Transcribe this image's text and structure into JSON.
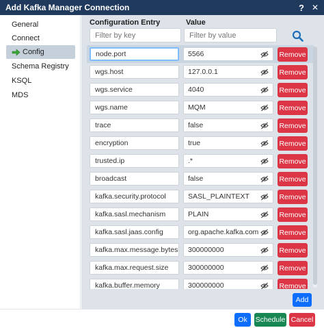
{
  "window": {
    "title": "Add Kafka Manager Connection",
    "help_label": "?",
    "close_label": "✕"
  },
  "sidebar": {
    "items": [
      {
        "label": "General"
      },
      {
        "label": "Connect"
      },
      {
        "label": "Config"
      },
      {
        "label": "Schema Registry"
      },
      {
        "label": "KSQL"
      },
      {
        "label": "MDS"
      }
    ],
    "active": "Config"
  },
  "config": {
    "key_header": "Configuration Entry",
    "value_header": "Value",
    "key_filter_placeholder": "Filter by key",
    "value_filter_placeholder": "Filter by value",
    "remove_label": "Remove",
    "add_label": "Add",
    "entries": [
      {
        "key": "node.port",
        "value": "5566"
      },
      {
        "key": "wgs.host",
        "value": "127.0.0.1"
      },
      {
        "key": "wgs.service",
        "value": "4040"
      },
      {
        "key": "wgs.name",
        "value": "MQM"
      },
      {
        "key": "trace",
        "value": "false"
      },
      {
        "key": "encryption",
        "value": "true"
      },
      {
        "key": "trusted.ip",
        "value": ".*"
      },
      {
        "key": "broadcast",
        "value": "false"
      },
      {
        "key": "kafka.security.protocol",
        "value": "SASL_PLAINTEXT"
      },
      {
        "key": "kafka.sasl.mechanism",
        "value": "PLAIN"
      },
      {
        "key": "kafka.sasl.jaas.config",
        "value": "org.apache.kafka.common.se"
      },
      {
        "key": "kafka.max.message.bytes",
        "value": "300000000"
      },
      {
        "key": "kafka.max.request.size",
        "value": "300000000"
      },
      {
        "key": "kafka.buffer.memory",
        "value": "300000000"
      }
    ]
  },
  "footer": {
    "ok_label": "Ok",
    "schedule_label": "Schedule",
    "cancel_label": "Cancel"
  },
  "colors": {
    "titlebar": "#1f3a5c",
    "primary": "#0d6efd",
    "danger": "#dc3545",
    "success": "#198754",
    "panel": "#dde3e9",
    "active_nav": "#c5d0da"
  },
  "icons": {
    "search": "search-icon",
    "visibility": "eye-slash-icon",
    "active_nav": "arrow-right-icon"
  }
}
